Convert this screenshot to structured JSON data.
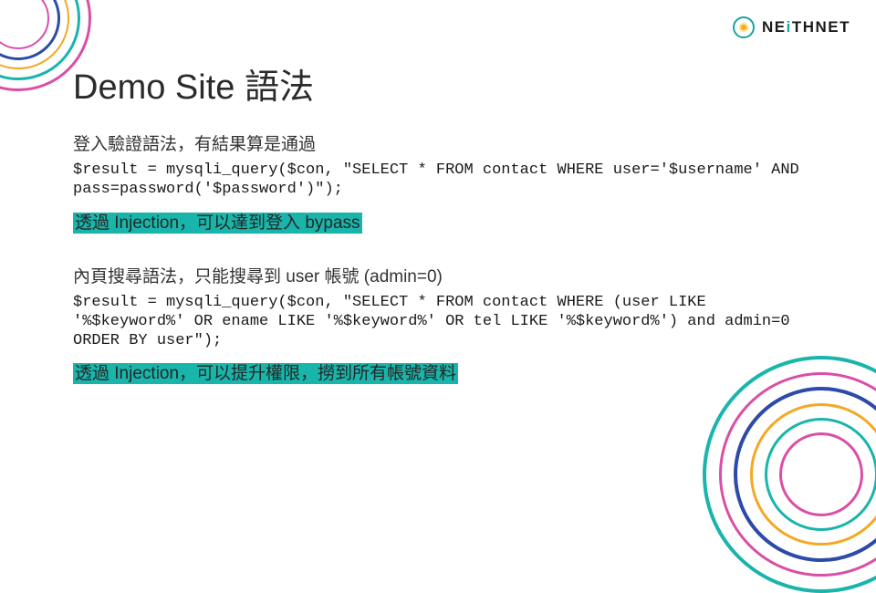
{
  "brand": {
    "name_a": "NE",
    "name_b": "i",
    "name_c": "THNET"
  },
  "title": "Demo Site 語法",
  "sections": [
    {
      "sub": "登入驗證語法，有結果算是通過",
      "code": "$result = mysqli_query($con, \"SELECT * FROM contact WHERE user='$username' AND pass=password('$password')\");",
      "hl": "透過 Injection，可以達到登入 bypass"
    },
    {
      "sub": "內頁搜尋語法，只能搜尋到 user 帳號 (admin=0)",
      "code": "$result = mysqli_query($con, \"SELECT * FROM contact WHERE (user LIKE '%$keyword%' OR ename LIKE '%$keyword%' OR tel LIKE '%$keyword%') and admin=0 ORDER BY user\");",
      "hl": "透過 Injection，可以提升權限，撈到所有帳號資料"
    }
  ]
}
